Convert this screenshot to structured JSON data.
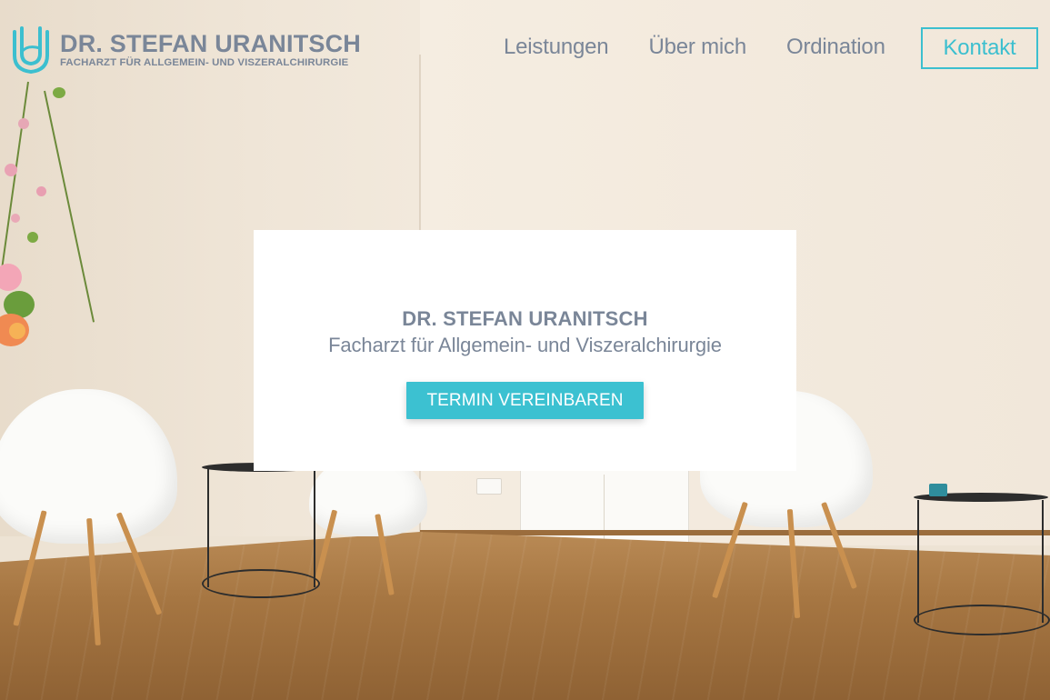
{
  "header": {
    "logo": {
      "name": "DR. STEFAN URANITSCH",
      "tagline": "FACHARZT FÜR ALLGEMEIN- UND VISZERALCHIRURGIE",
      "icon": "u-monogram-logo"
    },
    "nav": {
      "items": [
        {
          "label": "Leistungen"
        },
        {
          "label": "Über mich"
        },
        {
          "label": "Ordination"
        }
      ],
      "contact_label": "Kontakt"
    }
  },
  "hero": {
    "name": "DR. STEFAN URANITSCH",
    "subtitle": "Facharzt für Allgemein- und Viszeralchirurgie",
    "cta_label": "TERMIN VEREINBAREN"
  },
  "colors": {
    "accent": "#3cbfcf",
    "text": "#7a8698",
    "card_background": "#ffffff"
  }
}
